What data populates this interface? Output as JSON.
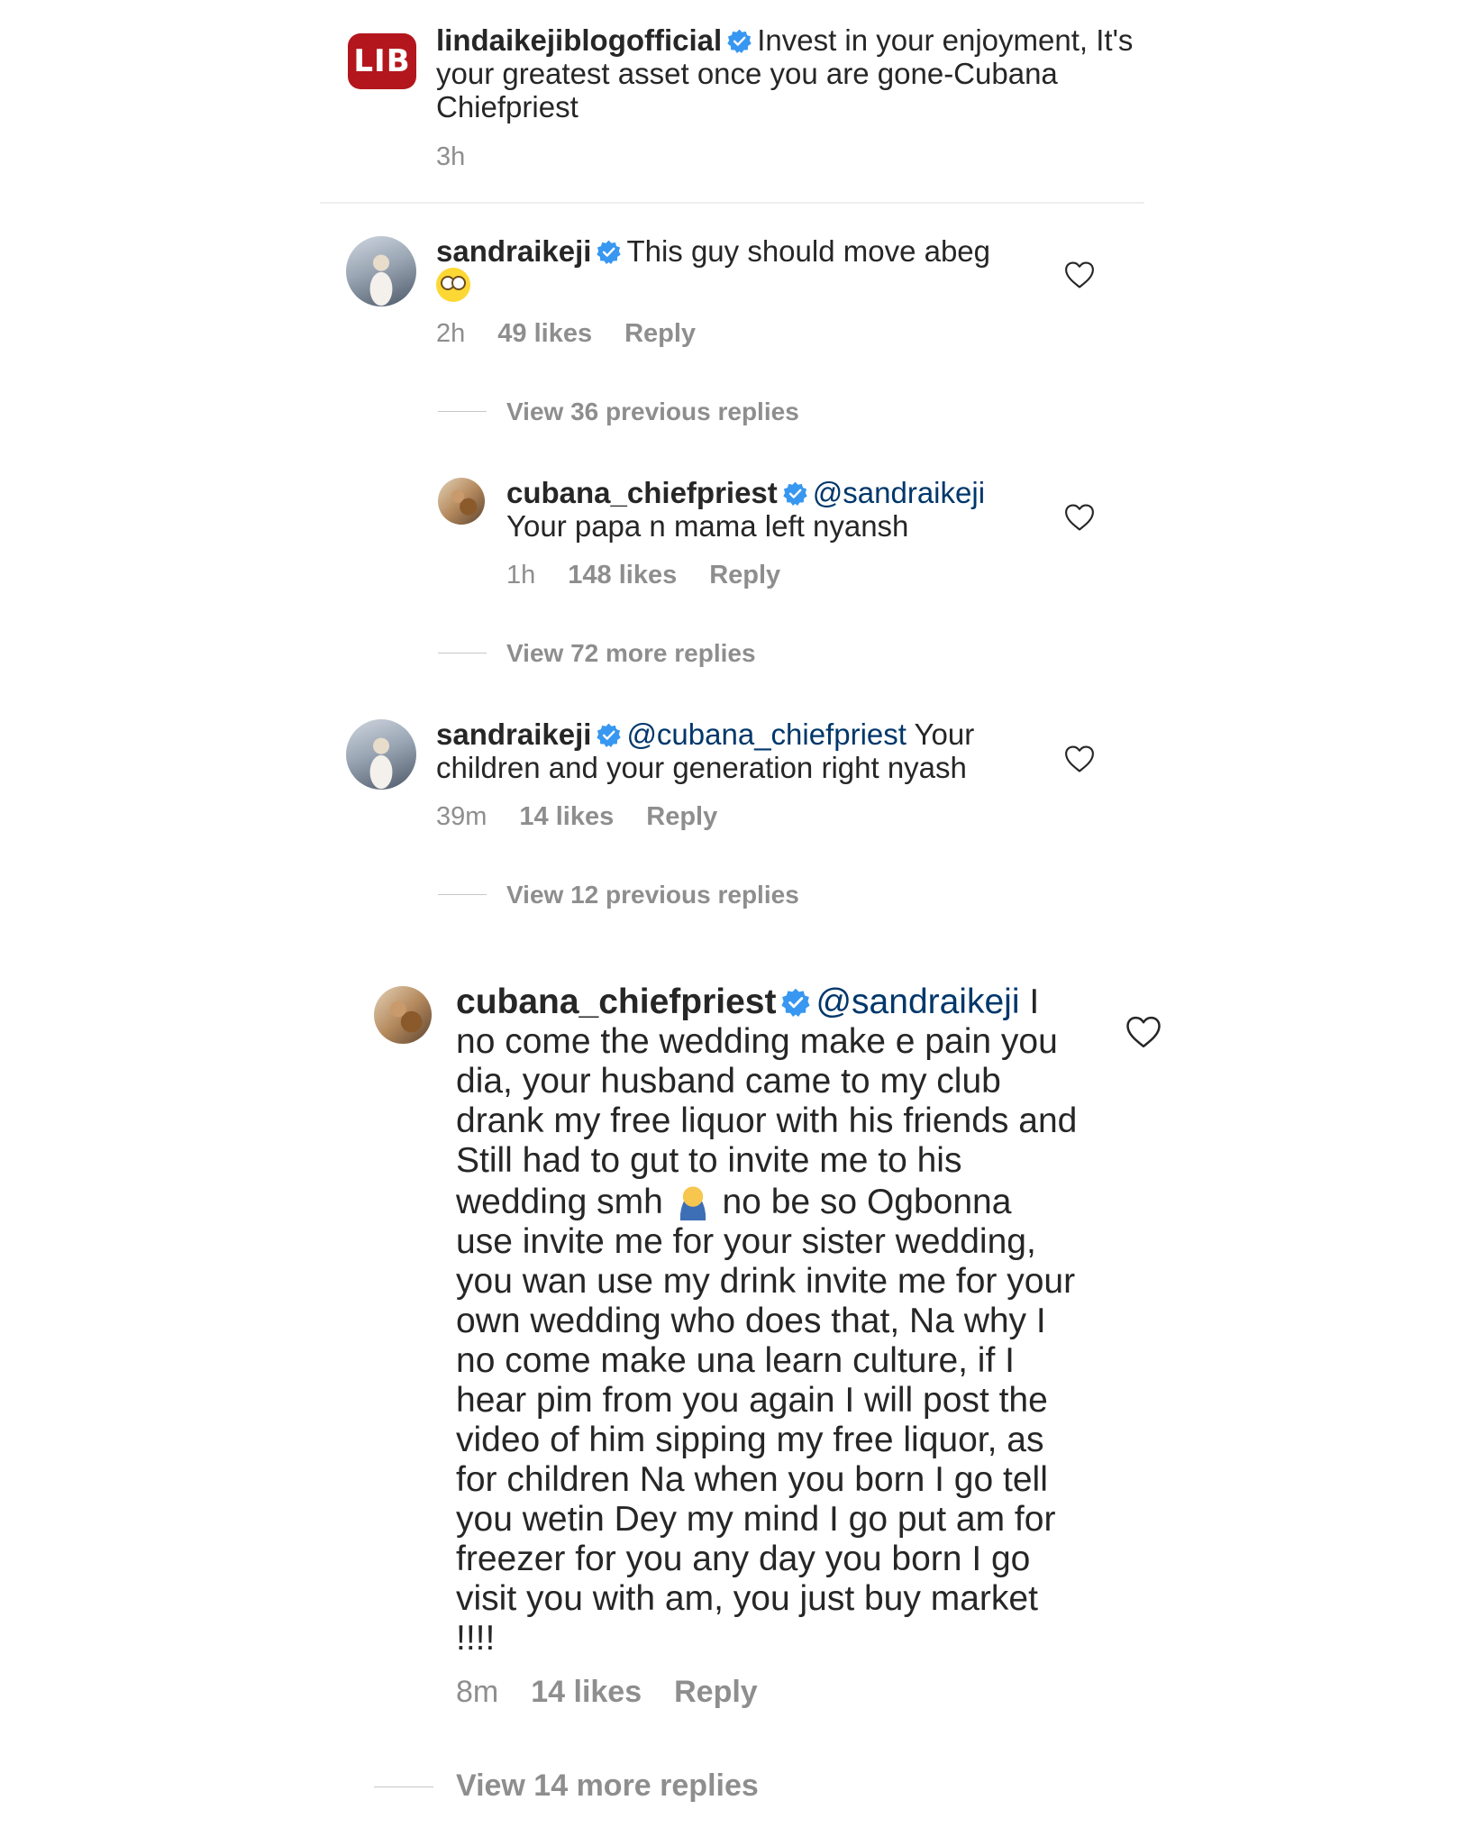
{
  "post": {
    "logo_text": "LIB",
    "username": "lindaikejiblogofficial",
    "caption": "Invest in your enjoyment, It's your greatest asset once you are gone-Cubana Chiefpriest",
    "time": "3h"
  },
  "comment1": {
    "username": "sandraikeji",
    "text": "This guy should move abeg",
    "emoji": "rolling-eyes-emoji",
    "time": "2h",
    "likes": "49 likes",
    "reply": "Reply",
    "view_replies": "View 36 previous replies"
  },
  "reply1": {
    "username": "cubana_chiefpriest",
    "mention": "@sandraikeji",
    "text": "Your papa n mama left nyansh",
    "time": "1h",
    "likes": "148 likes",
    "reply": "Reply",
    "view_replies": "View 72 more replies"
  },
  "comment2": {
    "username": "sandraikeji",
    "mention": "@cubana_chiefpriest",
    "text_line1": "Your",
    "text_line2": "children and your generation right nyash",
    "time": "39m",
    "likes": "14 likes",
    "reply": "Reply",
    "view_replies": "View 12 previous replies"
  },
  "reply2": {
    "username": "cubana_chiefpriest",
    "mention": "@sandraikeji",
    "text_part1": "I no come the wedding make e pain you dia, your husband came to my club drank my free liquor with his friends and Still had to gut to invite me to his wedding smh",
    "emoji": "facepalm-emoji",
    "text_part2": "no be so Ogbonna use invite me for your sister wedding, you wan use my drink invite me for your own wedding who does that, Na why I no come make una learn culture, if I hear pim from you again I will post the video of him sipping my free liquor, as for children Na when you born I go tell you wetin Dey my mind I go put am for freezer for you any day you born I go visit you with am, you just buy market !!!!",
    "time": "8m",
    "likes": "14 likes",
    "reply": "Reply",
    "view_replies": "View 14 more replies"
  },
  "colors": {
    "text": "#262626",
    "meta": "#8e8e8e",
    "mention": "#00376b",
    "verified": "#3897f0",
    "logo": "#b3171d"
  }
}
